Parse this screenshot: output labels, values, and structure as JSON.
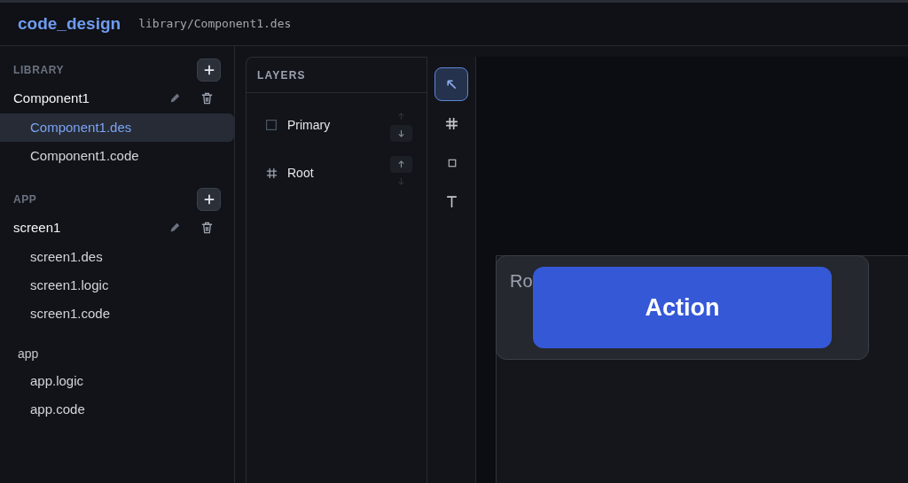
{
  "header": {
    "title": "code_design",
    "path": "library/Component1.des"
  },
  "sidebar": {
    "sections": [
      {
        "label": "LIBRARY",
        "groups": [
          {
            "name": "Component1",
            "editable": true,
            "files": [
              {
                "name": "Component1.des",
                "selected": true
              },
              {
                "name": "Component1.code",
                "selected": false
              }
            ]
          }
        ]
      },
      {
        "label": "APP",
        "groups": [
          {
            "name": "screen1",
            "editable": true,
            "files": [
              {
                "name": "screen1.des",
                "selected": false
              },
              {
                "name": "screen1.logic",
                "selected": false
              },
              {
                "name": "screen1.code",
                "selected": false
              }
            ]
          },
          {
            "name": "app",
            "editable": false,
            "files": [
              {
                "name": "app.logic",
                "selected": false
              },
              {
                "name": "app.code",
                "selected": false
              }
            ]
          }
        ]
      }
    ]
  },
  "layers": {
    "title": "LAYERS",
    "items": [
      {
        "name": "Primary",
        "kind": "rect",
        "up_disabled": true,
        "down_disabled": false
      },
      {
        "name": "Root",
        "kind": "frame",
        "up_disabled": false,
        "down_disabled": true
      }
    ]
  },
  "tools": [
    {
      "kind": "select",
      "selected": true
    },
    {
      "kind": "frame",
      "selected": false
    },
    {
      "kind": "rect",
      "selected": false
    },
    {
      "kind": "text",
      "selected": false
    }
  ],
  "canvas": {
    "frame_label": "Ro",
    "button_label": "Action"
  }
}
